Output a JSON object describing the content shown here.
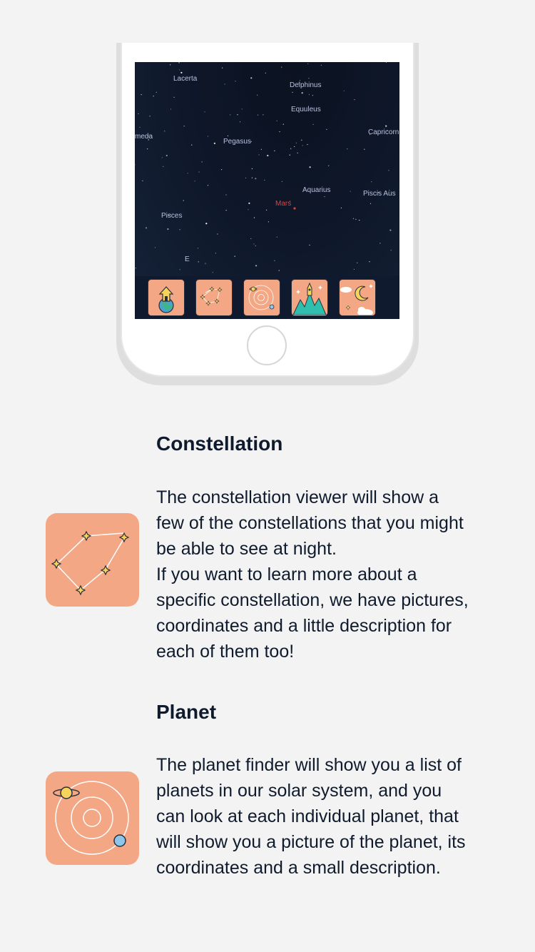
{
  "sky": {
    "labels": {
      "lacerta": "Lacerta",
      "delphinus": "Delphinus",
      "equuleus": "Equuleus",
      "andromeda": "meda",
      "pegasus": "Pegasus",
      "capricornus": "Capricorn",
      "aquarius": "Aquarius",
      "piscis_austrinus": "Piscis Aus",
      "mars": "Mars",
      "pisces": "Pisces",
      "east": "E"
    }
  },
  "tabs": [
    {
      "icon": "earth-home-icon"
    },
    {
      "icon": "constellation-icon"
    },
    {
      "icon": "planet-orbit-icon"
    },
    {
      "icon": "rocket-mountains-icon"
    },
    {
      "icon": "moon-clouds-icon"
    }
  ],
  "features": [
    {
      "title": "Constellation",
      "icon": "constellation-icon",
      "lines": [
        "The constellation viewer will show a",
        "few of the constellations that you might",
        "be able to see at night.",
        "If you want to learn more about a",
        "specific constellation, we have pictures,",
        "coordinates and a little description for",
        "each of them too!"
      ]
    },
    {
      "title": "Planet",
      "icon": "planet-orbit-icon",
      "lines": [
        "The planet finder will show you a list of",
        "planets in our solar system, and you",
        "can look at each individual planet, that",
        "will show you a picture of the planet, its",
        "coordinates and a small description."
      ]
    }
  ],
  "colors": {
    "tile": "#f4a784",
    "sky": "#0e1729",
    "text": "#0f1b2d",
    "mars": "#e0413f"
  }
}
